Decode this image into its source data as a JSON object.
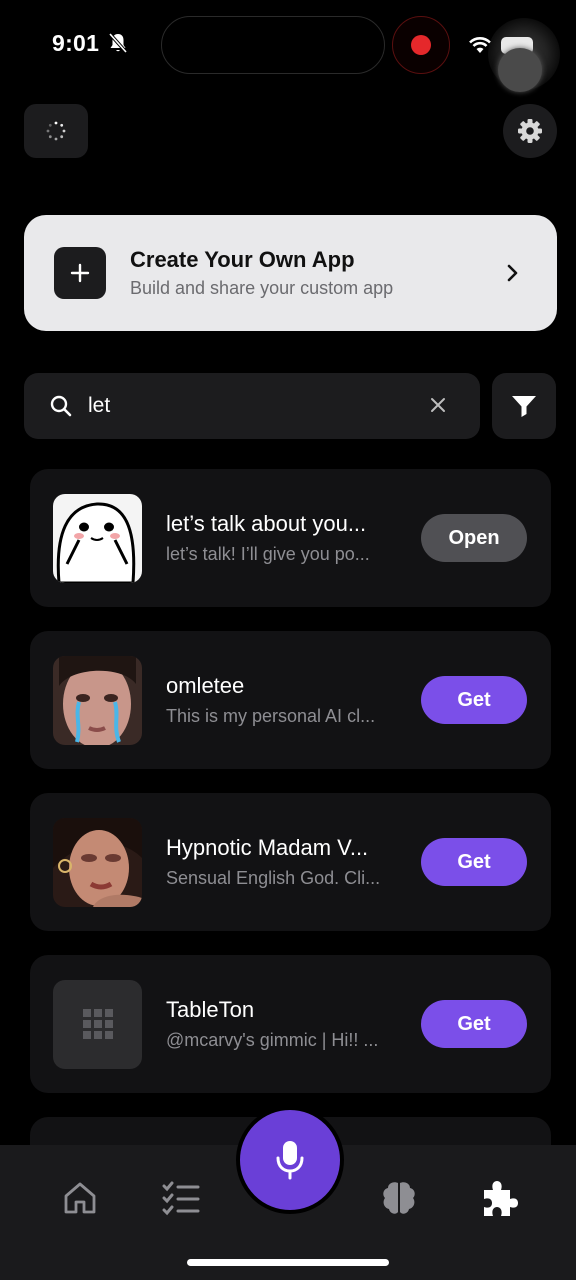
{
  "status_bar": {
    "time": "9:01"
  },
  "create_card": {
    "title": "Create Your Own App",
    "subtitle": "Build and share your custom app"
  },
  "search": {
    "value": "let"
  },
  "apps": [
    {
      "name": "let’s talk about you...",
      "desc": "let’s talk! I’ll give you po...",
      "action": "Open"
    },
    {
      "name": "omletee",
      "desc": "This is my personal AI cl...",
      "action": "Get"
    },
    {
      "name": "Hypnotic Madam V...",
      "desc": "Sensual English God. Cli...",
      "action": "Get"
    },
    {
      "name": "TableTon",
      "desc": "@mcarvy's gimmic | Hi!! ...",
      "action": "Get"
    }
  ],
  "tabbar": {
    "items": [
      "home-icon",
      "checklist-icon",
      "mic-icon",
      "brain-icon",
      "puzzle-icon"
    ],
    "active": "puzzle-icon"
  },
  "colors": {
    "accent": "#7b4fe9",
    "mic": "#6a3fd7",
    "background": "#000000"
  }
}
